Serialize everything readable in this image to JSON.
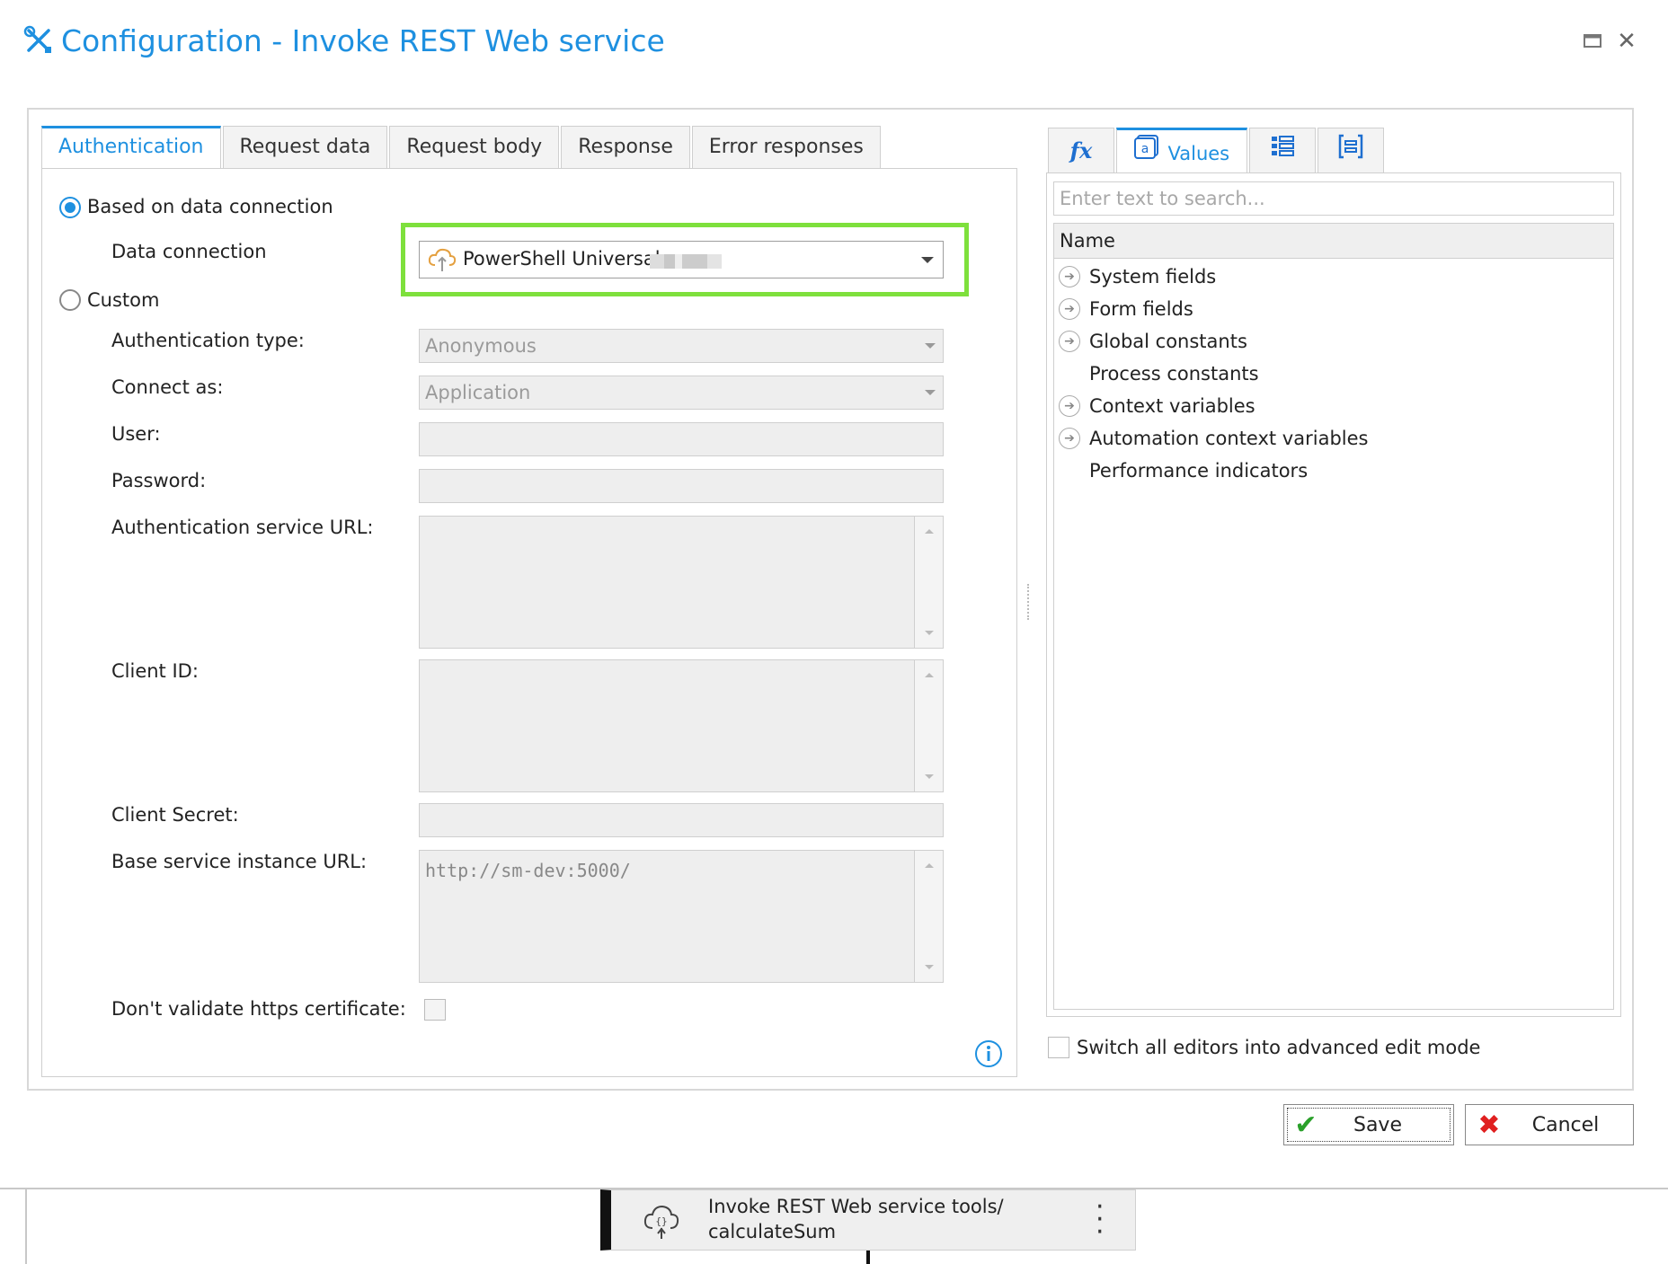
{
  "window": {
    "title": "Configuration - Invoke REST Web service",
    "maximize_icon": "maximize-icon",
    "close_icon": "close-icon"
  },
  "tabs": [
    "Authentication",
    "Request data",
    "Request body",
    "Response",
    "Error responses"
  ],
  "auth": {
    "based_on_connection_label": "Based on data connection",
    "data_connection_label": "Data connection",
    "data_connection_value": "PowerShell Universal",
    "custom_label": "Custom",
    "auth_type_label": "Authentication type:",
    "auth_type_value": "Anonymous",
    "connect_as_label": "Connect as:",
    "connect_as_value": "Application",
    "user_label": "User:",
    "password_label": "Password:",
    "auth_url_label": "Authentication service URL:",
    "client_id_label": "Client ID:",
    "client_secret_label": "Client Secret:",
    "base_url_label": "Base service instance URL:",
    "base_url_value": "http://sm-dev:5000/",
    "dont_validate_label": "Don't validate https certificate:"
  },
  "right": {
    "tabs": [
      {
        "icon": "function-icon",
        "label": "fx"
      },
      {
        "icon": "values-icon",
        "label": "Values"
      },
      {
        "icon": "list-icon",
        "label": ""
      },
      {
        "icon": "form-icon",
        "label": ""
      }
    ],
    "search_placeholder": "Enter text to search...",
    "column_header": "Name",
    "tree": [
      {
        "label": "System fields",
        "expandable": true
      },
      {
        "label": "Form fields",
        "expandable": true
      },
      {
        "label": "Global constants",
        "expandable": true
      },
      {
        "label": "Process constants",
        "expandable": false
      },
      {
        "label": "Context variables",
        "expandable": true
      },
      {
        "label": "Automation context variables",
        "expandable": true
      },
      {
        "label": "Performance indicators",
        "expandable": false
      }
    ],
    "advanced_mode_label": "Switch all editors into advanced edit mode"
  },
  "buttons": {
    "save_label": "Save",
    "cancel_label": "Cancel"
  },
  "workflow_node": {
    "line1": "Invoke REST Web service tools/",
    "line2": "calculateSum"
  },
  "colors": {
    "accent": "#1e90e0",
    "highlight": "#7ee03c"
  }
}
